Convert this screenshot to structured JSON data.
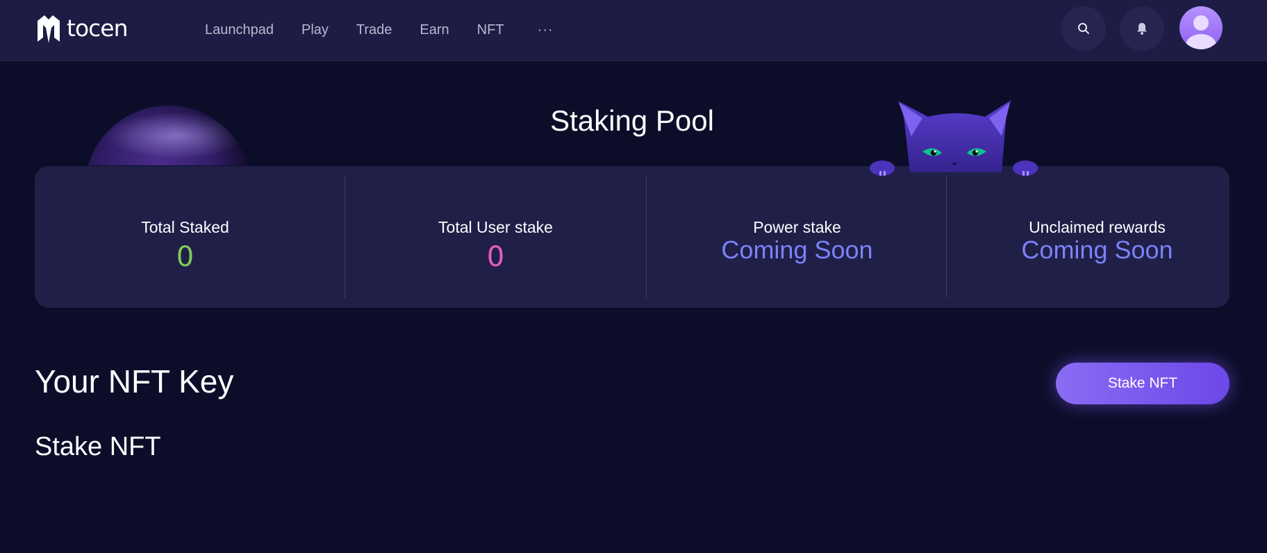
{
  "header": {
    "brand": "tocen",
    "nav": [
      "Launchpad",
      "Play",
      "Trade",
      "Earn",
      "NFT"
    ],
    "more": "···",
    "icons": {
      "search": "search-icon",
      "bell": "bell-icon",
      "avatar": "user-avatar"
    }
  },
  "hero": {
    "title": "Staking Pool"
  },
  "stats": [
    {
      "label": "Total Staked",
      "value": "0",
      "color": "#7ec95a"
    },
    {
      "label": "Total User stake",
      "value": "0",
      "color": "#e85bc4"
    },
    {
      "label": "Power stake",
      "value": "Coming Soon",
      "color": "#7b82f7"
    },
    {
      "label": "Unclaimed rewards",
      "value": "Coming Soon",
      "color": "#7b82f7"
    }
  ],
  "nft": {
    "section_title": "Your NFT Key",
    "stake_button": "Stake NFT",
    "sub_title": "Stake NFT"
  },
  "colors": {
    "background": "#0c0e29",
    "header": "#1c1c44",
    "card": "#201f48",
    "accent": "#7c5cf0"
  }
}
